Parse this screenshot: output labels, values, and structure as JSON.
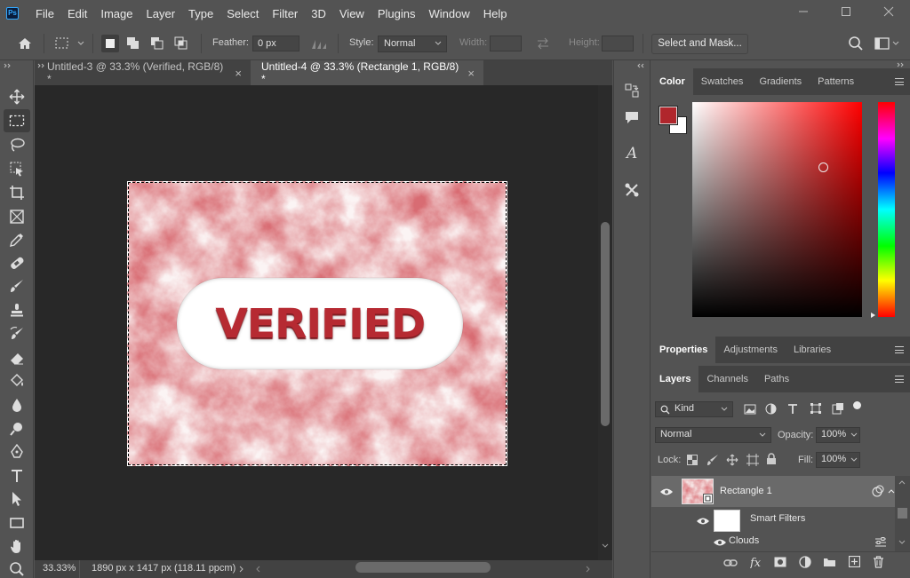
{
  "app": {
    "logo_text": "Ps",
    "menu": [
      "File",
      "Edit",
      "Image",
      "Layer",
      "Type",
      "Select",
      "Filter",
      "3D",
      "View",
      "Plugins",
      "Window",
      "Help"
    ]
  },
  "options_bar": {
    "feather_label": "Feather:",
    "feather_value": "0 px",
    "style_label": "Style:",
    "style_value": "Normal",
    "width_label": "Width:",
    "height_label": "Height:",
    "select_mask_label": "Select and Mask..."
  },
  "tabs": [
    {
      "label": "Untitled-3 @ 33.3% (Verified, RGB/8) *",
      "active": false
    },
    {
      "label": "Untitled-4 @ 33.3% (Rectangle 1, RGB/8) *",
      "active": true
    }
  ],
  "canvas": {
    "badge_text": "VERIFIED"
  },
  "status": {
    "zoom": "33.33%",
    "doc_info": "1890 px x 1417 px (118.11 ppcm)"
  },
  "color_panel": {
    "tabs": [
      "Color",
      "Swatches",
      "Gradients",
      "Patterns"
    ],
    "foreground": "#b0262c",
    "background": "#ffffff"
  },
  "properties_panel": {
    "tabs": [
      "Properties",
      "Adjustments",
      "Libraries"
    ]
  },
  "layers_panel": {
    "tabs": [
      "Layers",
      "Channels",
      "Paths"
    ],
    "filter_kind": "Kind",
    "blend_mode": "Normal",
    "opacity_label": "Opacity:",
    "opacity_value": "100%",
    "lock_label": "Lock:",
    "fill_label": "Fill:",
    "fill_value": "100%",
    "layers": [
      {
        "name": "Rectangle 1"
      },
      {
        "name": "Smart Filters"
      },
      {
        "name": "Clouds"
      }
    ]
  },
  "colors": {
    "accent_red": "#b62a32",
    "panel_bg": "#535353",
    "canvas_bg": "#282828"
  }
}
